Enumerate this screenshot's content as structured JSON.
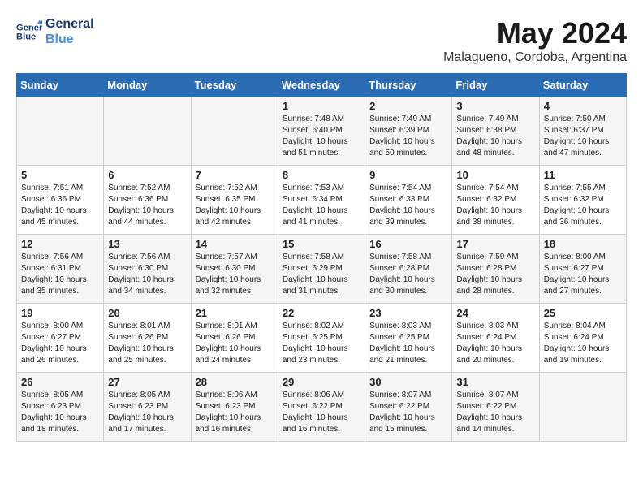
{
  "header": {
    "logo_line1": "General",
    "logo_line2": "Blue",
    "month_year": "May 2024",
    "location": "Malagueno, Cordoba, Argentina"
  },
  "days_of_week": [
    "Sunday",
    "Monday",
    "Tuesday",
    "Wednesday",
    "Thursday",
    "Friday",
    "Saturday"
  ],
  "weeks": [
    [
      {
        "day": "",
        "info": ""
      },
      {
        "day": "",
        "info": ""
      },
      {
        "day": "",
        "info": ""
      },
      {
        "day": "1",
        "info": "Sunrise: 7:48 AM\nSunset: 6:40 PM\nDaylight: 10 hours\nand 51 minutes."
      },
      {
        "day": "2",
        "info": "Sunrise: 7:49 AM\nSunset: 6:39 PM\nDaylight: 10 hours\nand 50 minutes."
      },
      {
        "day": "3",
        "info": "Sunrise: 7:49 AM\nSunset: 6:38 PM\nDaylight: 10 hours\nand 48 minutes."
      },
      {
        "day": "4",
        "info": "Sunrise: 7:50 AM\nSunset: 6:37 PM\nDaylight: 10 hours\nand 47 minutes."
      }
    ],
    [
      {
        "day": "5",
        "info": "Sunrise: 7:51 AM\nSunset: 6:36 PM\nDaylight: 10 hours\nand 45 minutes."
      },
      {
        "day": "6",
        "info": "Sunrise: 7:52 AM\nSunset: 6:36 PM\nDaylight: 10 hours\nand 44 minutes."
      },
      {
        "day": "7",
        "info": "Sunrise: 7:52 AM\nSunset: 6:35 PM\nDaylight: 10 hours\nand 42 minutes."
      },
      {
        "day": "8",
        "info": "Sunrise: 7:53 AM\nSunset: 6:34 PM\nDaylight: 10 hours\nand 41 minutes."
      },
      {
        "day": "9",
        "info": "Sunrise: 7:54 AM\nSunset: 6:33 PM\nDaylight: 10 hours\nand 39 minutes."
      },
      {
        "day": "10",
        "info": "Sunrise: 7:54 AM\nSunset: 6:32 PM\nDaylight: 10 hours\nand 38 minutes."
      },
      {
        "day": "11",
        "info": "Sunrise: 7:55 AM\nSunset: 6:32 PM\nDaylight: 10 hours\nand 36 minutes."
      }
    ],
    [
      {
        "day": "12",
        "info": "Sunrise: 7:56 AM\nSunset: 6:31 PM\nDaylight: 10 hours\nand 35 minutes."
      },
      {
        "day": "13",
        "info": "Sunrise: 7:56 AM\nSunset: 6:30 PM\nDaylight: 10 hours\nand 34 minutes."
      },
      {
        "day": "14",
        "info": "Sunrise: 7:57 AM\nSunset: 6:30 PM\nDaylight: 10 hours\nand 32 minutes."
      },
      {
        "day": "15",
        "info": "Sunrise: 7:58 AM\nSunset: 6:29 PM\nDaylight: 10 hours\nand 31 minutes."
      },
      {
        "day": "16",
        "info": "Sunrise: 7:58 AM\nSunset: 6:28 PM\nDaylight: 10 hours\nand 30 minutes."
      },
      {
        "day": "17",
        "info": "Sunrise: 7:59 AM\nSunset: 6:28 PM\nDaylight: 10 hours\nand 28 minutes."
      },
      {
        "day": "18",
        "info": "Sunrise: 8:00 AM\nSunset: 6:27 PM\nDaylight: 10 hours\nand 27 minutes."
      }
    ],
    [
      {
        "day": "19",
        "info": "Sunrise: 8:00 AM\nSunset: 6:27 PM\nDaylight: 10 hours\nand 26 minutes."
      },
      {
        "day": "20",
        "info": "Sunrise: 8:01 AM\nSunset: 6:26 PM\nDaylight: 10 hours\nand 25 minutes."
      },
      {
        "day": "21",
        "info": "Sunrise: 8:01 AM\nSunset: 6:26 PM\nDaylight: 10 hours\nand 24 minutes."
      },
      {
        "day": "22",
        "info": "Sunrise: 8:02 AM\nSunset: 6:25 PM\nDaylight: 10 hours\nand 23 minutes."
      },
      {
        "day": "23",
        "info": "Sunrise: 8:03 AM\nSunset: 6:25 PM\nDaylight: 10 hours\nand 21 minutes."
      },
      {
        "day": "24",
        "info": "Sunrise: 8:03 AM\nSunset: 6:24 PM\nDaylight: 10 hours\nand 20 minutes."
      },
      {
        "day": "25",
        "info": "Sunrise: 8:04 AM\nSunset: 6:24 PM\nDaylight: 10 hours\nand 19 minutes."
      }
    ],
    [
      {
        "day": "26",
        "info": "Sunrise: 8:05 AM\nSunset: 6:23 PM\nDaylight: 10 hours\nand 18 minutes."
      },
      {
        "day": "27",
        "info": "Sunrise: 8:05 AM\nSunset: 6:23 PM\nDaylight: 10 hours\nand 17 minutes."
      },
      {
        "day": "28",
        "info": "Sunrise: 8:06 AM\nSunset: 6:23 PM\nDaylight: 10 hours\nand 16 minutes."
      },
      {
        "day": "29",
        "info": "Sunrise: 8:06 AM\nSunset: 6:22 PM\nDaylight: 10 hours\nand 16 minutes."
      },
      {
        "day": "30",
        "info": "Sunrise: 8:07 AM\nSunset: 6:22 PM\nDaylight: 10 hours\nand 15 minutes."
      },
      {
        "day": "31",
        "info": "Sunrise: 8:07 AM\nSunset: 6:22 PM\nDaylight: 10 hours\nand 14 minutes."
      },
      {
        "day": "",
        "info": ""
      }
    ]
  ]
}
